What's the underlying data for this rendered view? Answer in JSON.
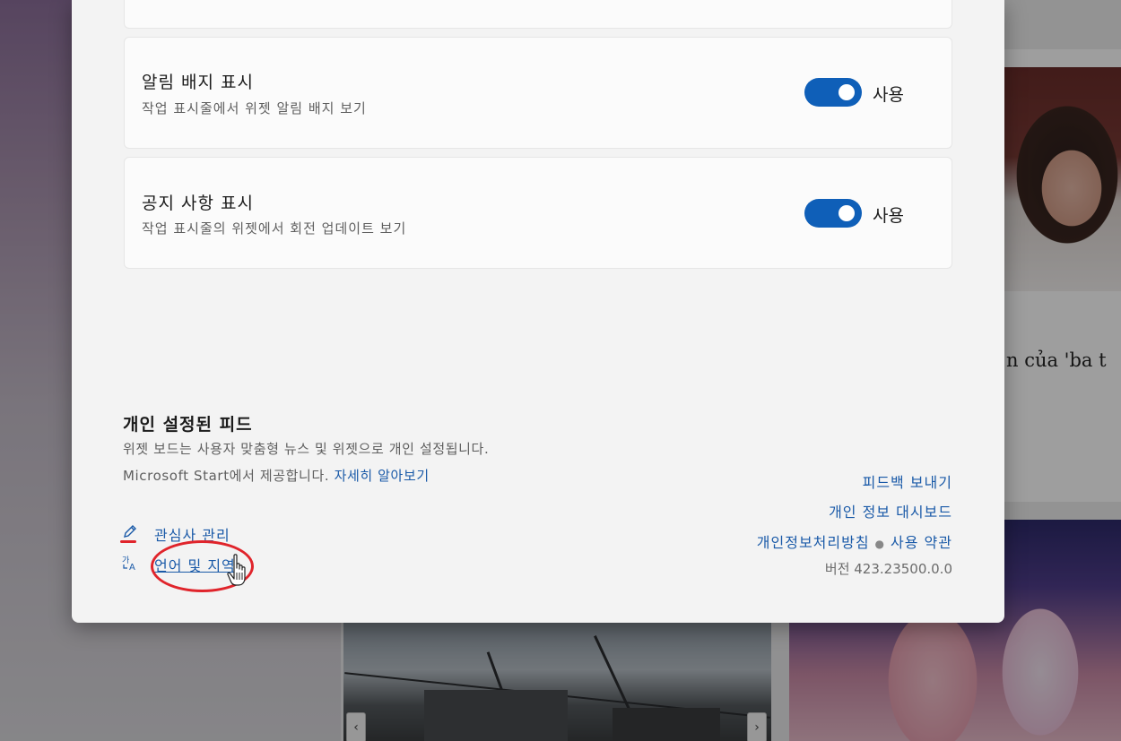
{
  "background": {
    "headline_fragment": "n của 'ba t",
    "arrows": {
      "left": "‹",
      "right": "›"
    }
  },
  "settings": {
    "cards": [
      {
        "title": "알림 배지 표시",
        "description": "작업 표시줄에서 위젯 알림 배지 보기",
        "toggle_on": true,
        "toggle_label": "사용"
      },
      {
        "title": "공지 사항 표시",
        "description": "작업 표시줄의 위젯에서 회전 업데이트 보기",
        "toggle_on": true,
        "toggle_label": "사용"
      }
    ],
    "toggle_color": "#0f5fb8"
  },
  "feed": {
    "title": "개인 설정된 피드",
    "line1": "위젯 보드는 사용자 맞춤형 뉴스 및 위젯으로 개인 설정됩니다.",
    "line2_prefix": "Microsoft Start에서 제공합니다.",
    "learn_more": "자세히 알아보기"
  },
  "bottom_links": {
    "manage_interests": "관심사 관리",
    "manage_interests_icon": "pencil-icon",
    "language_region": "언어 및 지역",
    "language_region_icon": "language-icon"
  },
  "right_links": {
    "feedback": "피드백 보내기",
    "privacy_dashboard": "개인 정보 대시보드",
    "privacy_policy": "개인정보처리방침",
    "terms": "사용 약관",
    "version": "버전 423.23500.0.0"
  },
  "annotation": {
    "highlight_color": "#e0242b"
  }
}
